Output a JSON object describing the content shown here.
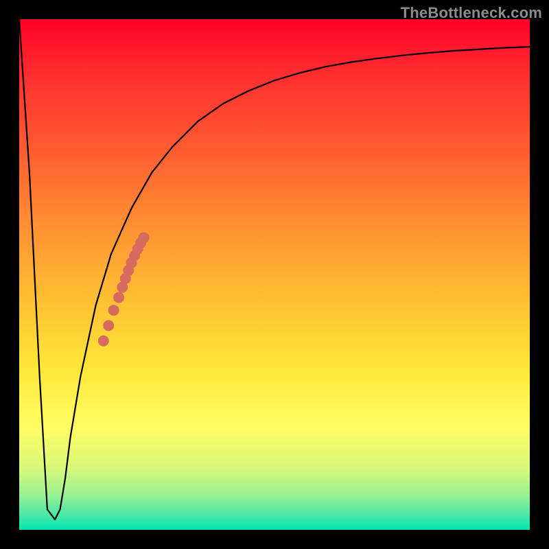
{
  "watermark": "TheBottleneck.com",
  "chart_data": {
    "type": "line",
    "title": "",
    "xlabel": "",
    "ylabel": "",
    "xlim": [
      0,
      100
    ],
    "ylim": [
      0,
      100
    ],
    "grid": false,
    "legend": false,
    "series": [
      {
        "name": "bottleneck-curve",
        "x": [
          0,
          2,
          4,
          5.5,
          7,
          8,
          9,
          10,
          12,
          15,
          18,
          22,
          26,
          30,
          35,
          40,
          45,
          50,
          55,
          60,
          65,
          70,
          75,
          80,
          85,
          90,
          95,
          100
        ],
        "y": [
          100,
          70,
          30,
          4,
          2,
          4,
          10,
          18,
          30,
          44,
          54,
          63,
          70,
          75,
          80,
          83.5,
          86,
          88,
          89.5,
          90.7,
          91.6,
          92.3,
          92.9,
          93.4,
          93.8,
          94.1,
          94.4,
          94.6
        ]
      }
    ],
    "highlight_points": {
      "name": "highlight-dots",
      "color": "#d76b5f",
      "points": [
        {
          "x": 16.5,
          "y": 37
        },
        {
          "x": 17.5,
          "y": 40
        },
        {
          "x": 18.5,
          "y": 43
        },
        {
          "x": 19.5,
          "y": 45.5
        },
        {
          "x": 20.2,
          "y": 47.5
        },
        {
          "x": 20.8,
          "y": 49.2
        },
        {
          "x": 21.4,
          "y": 50.8
        },
        {
          "x": 22.0,
          "y": 52.3
        },
        {
          "x": 22.6,
          "y": 53.7
        },
        {
          "x": 23.2,
          "y": 55.0
        },
        {
          "x": 23.8,
          "y": 56.2
        },
        {
          "x": 24.4,
          "y": 57.2
        }
      ]
    }
  }
}
